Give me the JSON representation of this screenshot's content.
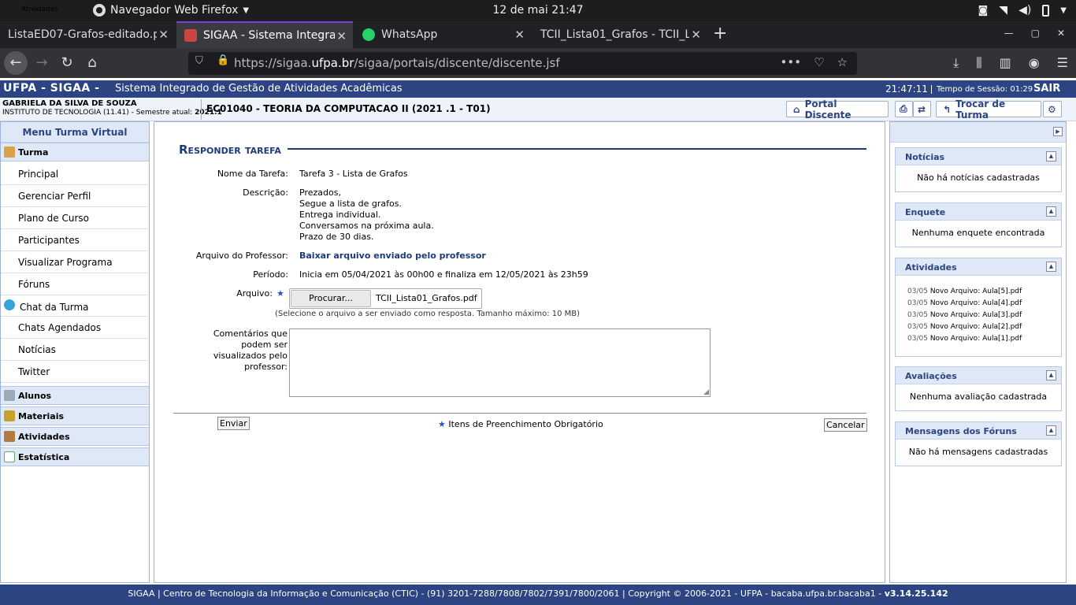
{
  "os": {
    "activities": "Atividades",
    "app": "Navegador Web Firefox",
    "clock": "12 de mai  21:47"
  },
  "browser": {
    "tabs": [
      {
        "label": "ListaED07-Grafos-editado.p"
      },
      {
        "label": "SIGAA - Sistema Integrad"
      },
      {
        "label": "WhatsApp"
      },
      {
        "label": "TCII_Lista01_Grafos - TCII_Li"
      }
    ],
    "url_prefix": "https://sigaa.",
    "url_domain": "ufpa.br",
    "url_path": "/sigaa/portais/discente/discente.jsf"
  },
  "header": {
    "logo": "UFPA - SIGAA -",
    "system": "Sistema Integrado de Gestão de Atividades Acadêmicas",
    "time": "21:47:11",
    "session": "Tempo de Sessão: 01:29",
    "logout": "SAIR"
  },
  "user": {
    "name": "GABRIELA DA SILVA DE SOUZA",
    "institute": "INSTITUTO DE TECNOLOGIA (11.41) - Semestre atual:",
    "semester": "2021.1",
    "course": "EC01040 - TEORIA DA COMPUTACAO II (2021 .1 - T01)",
    "portal_btn": "Portal Discente",
    "switch_btn": "Trocar de Turma"
  },
  "menu": {
    "title": "Menu Turma Virtual",
    "turma": "Turma",
    "items": [
      "Principal",
      "Gerenciar Perfil",
      "Plano de Curso",
      "Participantes",
      "Visualizar Programa",
      "Fóruns"
    ],
    "chat": "Chat da Turma",
    "items2": [
      "Chats Agendados",
      "Notícias",
      "Twitter"
    ],
    "sections": [
      "Alunos",
      "Materiais",
      "Atividades",
      "Estatística"
    ]
  },
  "form": {
    "title": "Responder tarefa",
    "task_label": "Nome da Tarefa:",
    "task_value": "Tarefa 3 - Lista de Grafos",
    "desc_label": "Descrição:",
    "desc_lines": [
      "Prezados,",
      "Segue a lista de grafos.",
      "Entrega individual.",
      "Conversamos na próxima aula.",
      "Prazo de 30 dias."
    ],
    "prof_label": "Arquivo do Professor:",
    "prof_link": "Baixar arquivo enviado pelo professor",
    "period_label": "Período:",
    "period_value": "Inicia em 05/04/2021 às 00h00 e finaliza em 12/05/2021 às 23h59",
    "file_label": "Arquivo:",
    "browse": "Procurar...",
    "filename": "TCII_Lista01_Grafos.pdf",
    "file_hint": "(Selecione o arquivo a ser enviado como resposta. Tamanho máximo: 10 MB)",
    "comments_label_lines": [
      "Comentários que",
      "podem ser",
      "visualizados pelo",
      "professor:"
    ],
    "send": "Enviar",
    "required": "Itens de Preenchimento Obrigatório",
    "cancel": "Cancelar"
  },
  "side": {
    "news_title": "Notícias",
    "news_text": "Não há notícias cadastradas",
    "poll_title": "Enquete",
    "poll_text": "Nenhuma enquete encontrada",
    "act_title": "Atividades",
    "activities": [
      {
        "date": "03/05",
        "text": "Novo Arquivo: Aula[5].pdf"
      },
      {
        "date": "03/05",
        "text": "Novo Arquivo: Aula[4].pdf"
      },
      {
        "date": "03/05",
        "text": "Novo Arquivo: Aula[3].pdf"
      },
      {
        "date": "03/05",
        "text": "Novo Arquivo: Aula[2].pdf"
      },
      {
        "date": "03/05",
        "text": "Novo Arquivo: Aula[1].pdf"
      }
    ],
    "eval_title": "Avaliações",
    "eval_text": "Nenhuma avaliação cadastrada",
    "forum_title": "Mensagens dos Fóruns",
    "forum_text": "Não há mensagens cadastradas"
  },
  "footer": {
    "text": "SIGAA | Centro de Tecnologia da Informação e Comunicação (CTIC) - (91) 3201-7288/7808/7802/7391/7800/2061 | Copyright © 2006-2021 - UFPA - bacaba.ufpa.br.bacaba1 - ",
    "version": "v3.14.25.142"
  }
}
